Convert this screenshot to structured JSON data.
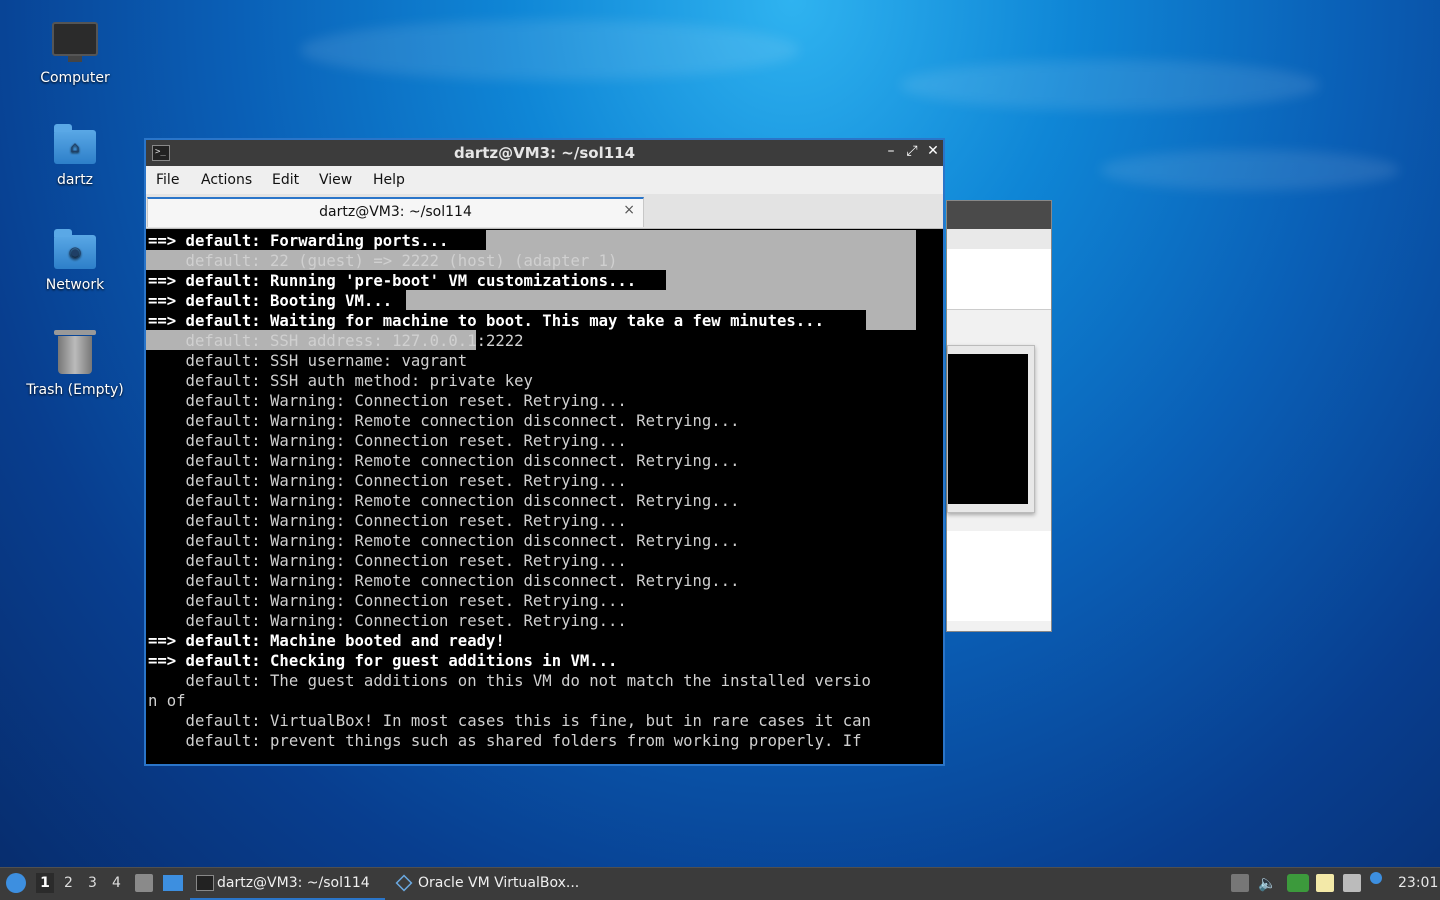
{
  "desktop": {
    "icons": [
      {
        "label": "Computer"
      },
      {
        "label": "dartz"
      },
      {
        "label": "Network"
      },
      {
        "label": "Trash (Empty)"
      }
    ]
  },
  "terminal_window": {
    "title": "dartz@VM3: ~/sol114",
    "controls": {
      "minimize": "–",
      "maximize": "⤢",
      "close": "✕"
    },
    "menu": [
      "File",
      "Actions",
      "Edit",
      "View",
      "Help"
    ],
    "tab": {
      "label": "dartz@VM3: ~/sol114",
      "close": "×"
    },
    "lines": [
      {
        "text": "==> default: Forwarding ports...",
        "bold": true
      },
      {
        "text": "    default: 22 (guest) => 2222 (host) (adapter 1)",
        "bold": false
      },
      {
        "text": "==> default: Running 'pre-boot' VM customizations...",
        "bold": true
      },
      {
        "text": "==> default: Booting VM...",
        "bold": true
      },
      {
        "text": "==> default: Waiting for machine to boot. This may take a few minutes...",
        "bold": true
      },
      {
        "text": "    default: SSH address: 127.0.0.1:2222",
        "bold": false
      },
      {
        "text": "    default: SSH username: vagrant",
        "bold": false
      },
      {
        "text": "    default: SSH auth method: private key",
        "bold": false
      },
      {
        "text": "    default: Warning: Connection reset. Retrying...",
        "bold": false
      },
      {
        "text": "    default: Warning: Remote connection disconnect. Retrying...",
        "bold": false
      },
      {
        "text": "    default: Warning: Connection reset. Retrying...",
        "bold": false
      },
      {
        "text": "    default: Warning: Remote connection disconnect. Retrying...",
        "bold": false
      },
      {
        "text": "    default: Warning: Connection reset. Retrying...",
        "bold": false
      },
      {
        "text": "    default: Warning: Remote connection disconnect. Retrying...",
        "bold": false
      },
      {
        "text": "    default: Warning: Connection reset. Retrying...",
        "bold": false
      },
      {
        "text": "    default: Warning: Remote connection disconnect. Retrying...",
        "bold": false
      },
      {
        "text": "    default: Warning: Connection reset. Retrying...",
        "bold": false
      },
      {
        "text": "    default: Warning: Remote connection disconnect. Retrying...",
        "bold": false
      },
      {
        "text": "    default: Warning: Connection reset. Retrying...",
        "bold": false
      },
      {
        "text": "    default: Warning: Connection reset. Retrying...",
        "bold": false
      },
      {
        "text": "==> default: Machine booted and ready!",
        "bold": true
      },
      {
        "text": "==> default: Checking for guest additions in VM...",
        "bold": true
      },
      {
        "text": "    default: The guest additions on this VM do not match the installed versio",
        "bold": false
      },
      {
        "text": "n of",
        "bold": false
      },
      {
        "text": "    default: VirtualBox! In most cases this is fine, but in rare cases it can",
        "bold": false
      },
      {
        "text": "    default: prevent things such as shared folders from working properly. If",
        "bold": false
      }
    ]
  },
  "taskbar": {
    "workspaces": [
      "1",
      "2",
      "3",
      "4"
    ],
    "tasks": [
      {
        "label": "dartz@VM3: ~/sol114",
        "active": true
      },
      {
        "label": "Oracle VM VirtualBox...",
        "active": false
      }
    ],
    "clock": "23:01"
  },
  "colors": {
    "accent": "#2a75c9",
    "selection": "#b3b3b3",
    "terminal_bg": "#000000",
    "taskbar_bg": "#3b3b3b"
  }
}
